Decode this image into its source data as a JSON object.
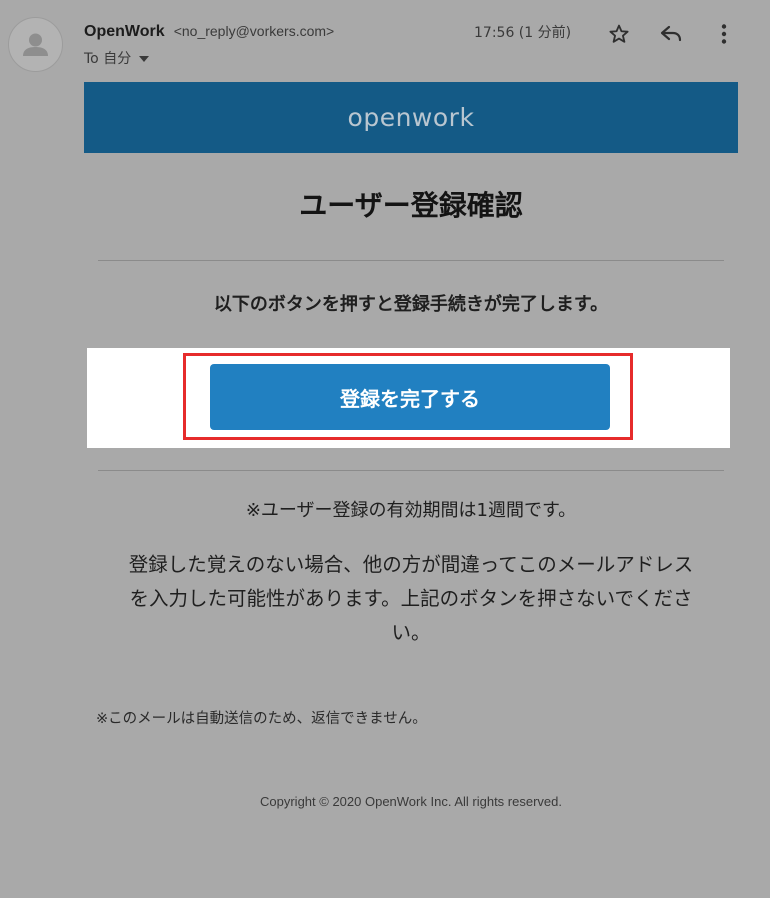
{
  "header": {
    "sender_name": "OpenWork",
    "sender_email": "<no_reply@vorkers.com>",
    "recipient": "To 自分",
    "timestamp": "17:56 (1 分前)",
    "icons": {
      "avatar": "person-icon",
      "star": "star-icon",
      "reply": "reply-icon",
      "more": "more-vertical-icon",
      "recipient_toggle": "caret-down-icon"
    }
  },
  "email": {
    "logo_text": "openwork",
    "title": "ユーザー登録確認",
    "instruction": "以下のボタンを押すと登録手続きが完了します。",
    "cta_label": "登録を完了する",
    "validity_note": "※ユーザー登録の有効期間は1週間です。",
    "notice_lines": [
      "登録した覚えのない場合、他の方が間違ってこのメールアドレス",
      "を入力した可能性があります。上記のボタンを押さないでくださ",
      "い。"
    ],
    "auto_reply_note": "※このメールは自動送信のため、返信できません。",
    "copyright": "Copyright © 2020 OpenWork Inc. All rights reserved."
  },
  "colors": {
    "banner": "#145a86",
    "cta_button": "#2180c1",
    "highlight_border": "#e62b2b",
    "overlay_background": "#a9a9a9"
  }
}
